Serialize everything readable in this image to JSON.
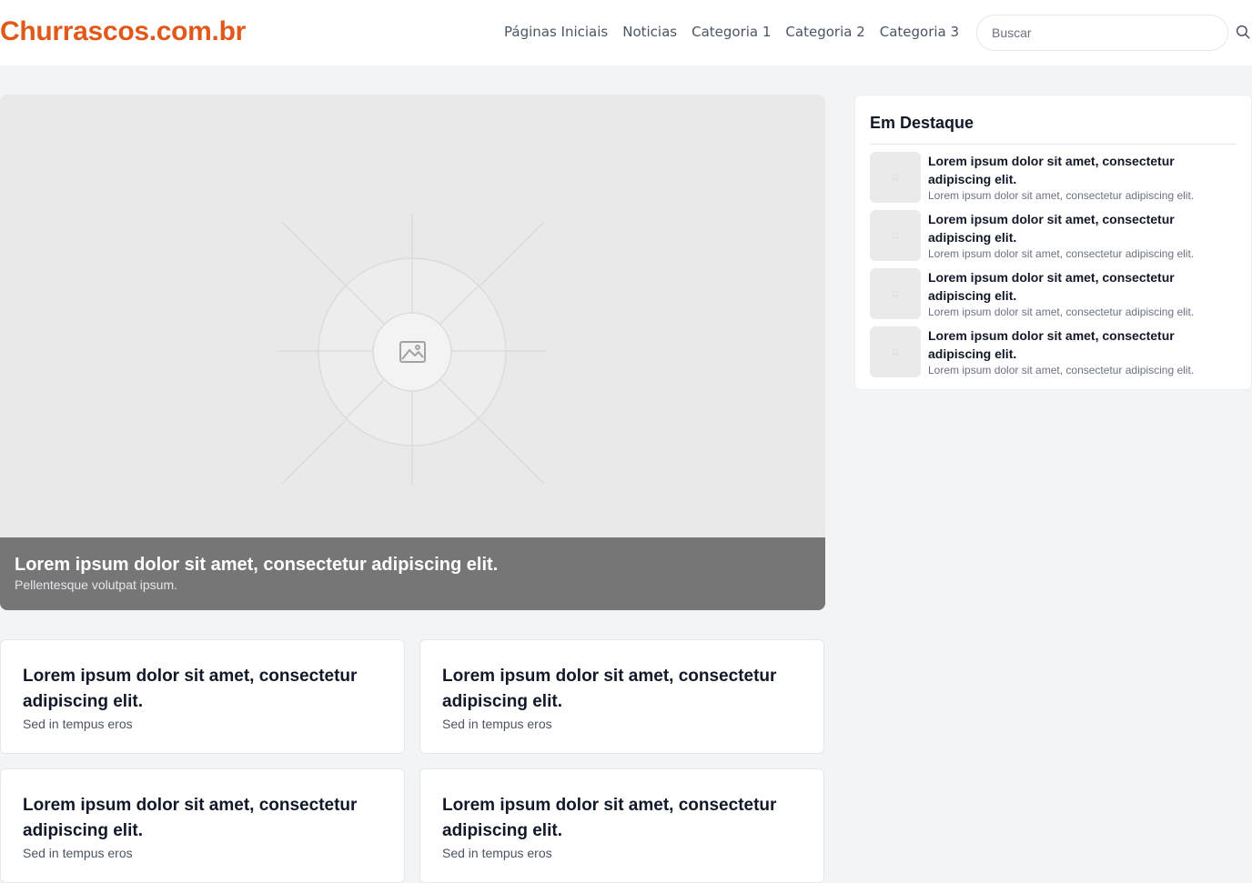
{
  "header": {
    "logo": "Churrascos.com.br",
    "nav": [
      "Páginas Iniciais",
      "Noticias",
      "Categoria 1",
      "Categoria 2",
      "Categoria 3"
    ],
    "search_placeholder": "Buscar"
  },
  "hero": {
    "title": "Lorem ipsum dolor sit amet, consectetur adipiscing elit.",
    "subtitle": "Pellentesque volutpat ipsum."
  },
  "cards": [
    {
      "title": "Lorem ipsum dolor sit amet, consectetur adipiscing elit.",
      "subtitle": "Sed in tempus eros"
    },
    {
      "title": "Lorem ipsum dolor sit amet, consectetur adipiscing elit.",
      "subtitle": "Sed in tempus eros"
    },
    {
      "title": "Lorem ipsum dolor sit amet, consectetur adipiscing elit.",
      "subtitle": "Sed in tempus eros"
    },
    {
      "title": "Lorem ipsum dolor sit amet, consectetur adipiscing elit.",
      "subtitle": "Sed in tempus eros"
    }
  ],
  "sidebar": {
    "title": "Em Destaque",
    "items": [
      {
        "title": "Lorem ipsum dolor sit amet, consectetur adipiscing elit.",
        "subtitle": "Lorem ipsum dolor sit amet, consectetur adipiscing elit."
      },
      {
        "title": "Lorem ipsum dolor sit amet, consectetur adipiscing elit.",
        "subtitle": "Lorem ipsum dolor sit amet, consectetur adipiscing elit."
      },
      {
        "title": "Lorem ipsum dolor sit amet, consectetur adipiscing elit.",
        "subtitle": "Lorem ipsum dolor sit amet, consectetur adipiscing elit."
      },
      {
        "title": "Lorem ipsum dolor sit amet, consectetur adipiscing elit.",
        "subtitle": "Lorem ipsum dolor sit amet, consectetur adipiscing elit."
      }
    ]
  },
  "icons": {
    "search": "search-icon",
    "image_placeholder": "image-icon"
  },
  "colors": {
    "brand": "#e0591b",
    "page_bg": "#f3f4f6",
    "caption_bg": "#767676"
  }
}
